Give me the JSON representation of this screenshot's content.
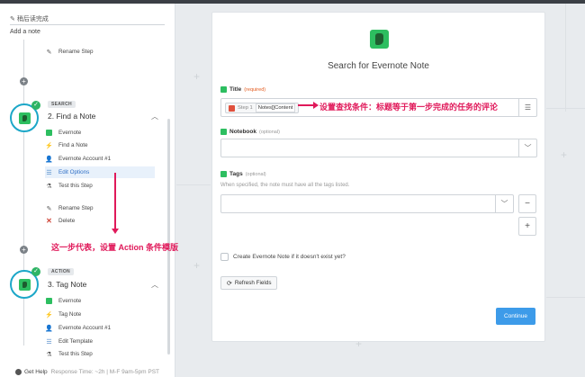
{
  "sidebar": {
    "zap_name": "稍后读完成",
    "add_note": "Add a note",
    "rename_step_top": "Rename Step",
    "step2": {
      "badge": "SEARCH",
      "title": "2. Find a Note",
      "items": [
        "Evernote",
        "Find a Note",
        "Evernote Account #1",
        "Edit Options",
        "Test this Step"
      ],
      "actions": [
        "Rename Step",
        "Delete"
      ]
    },
    "step3": {
      "badge": "ACTION",
      "title": "3. Tag Note",
      "items": [
        "Evernote",
        "Tag Note",
        "Evernote Account #1",
        "Edit Template",
        "Test this Step"
      ]
    },
    "help": {
      "label": "Get Help",
      "meta": "Response Time: ~2h | M-F 9am-5pm PST"
    }
  },
  "card": {
    "title": "Search for Evernote Note",
    "fields": {
      "title": {
        "label": "Title",
        "required": "(required)",
        "pill_step": "Step 1",
        "pill_value": "Notes[]Content"
      },
      "notebook": {
        "label": "Notebook",
        "optional": "(optional)"
      },
      "tags": {
        "label": "Tags",
        "optional": "(optional)",
        "help": "When specified, the note must have all the tags listed."
      }
    },
    "checkbox_label": "Create Evernote Note if it doesn't exist yet?",
    "refresh_label": "Refresh Fields",
    "continue_label": "Continue"
  },
  "annotations": {
    "title_note": "设置查找条件：标题等于第一步完成的任务的评论",
    "step_note": "这一步代表，设置 Action 条件模版"
  },
  "colors": {
    "accent": "#3d9be9",
    "evernote": "#2dbe60",
    "annotation": "#e0195a"
  }
}
